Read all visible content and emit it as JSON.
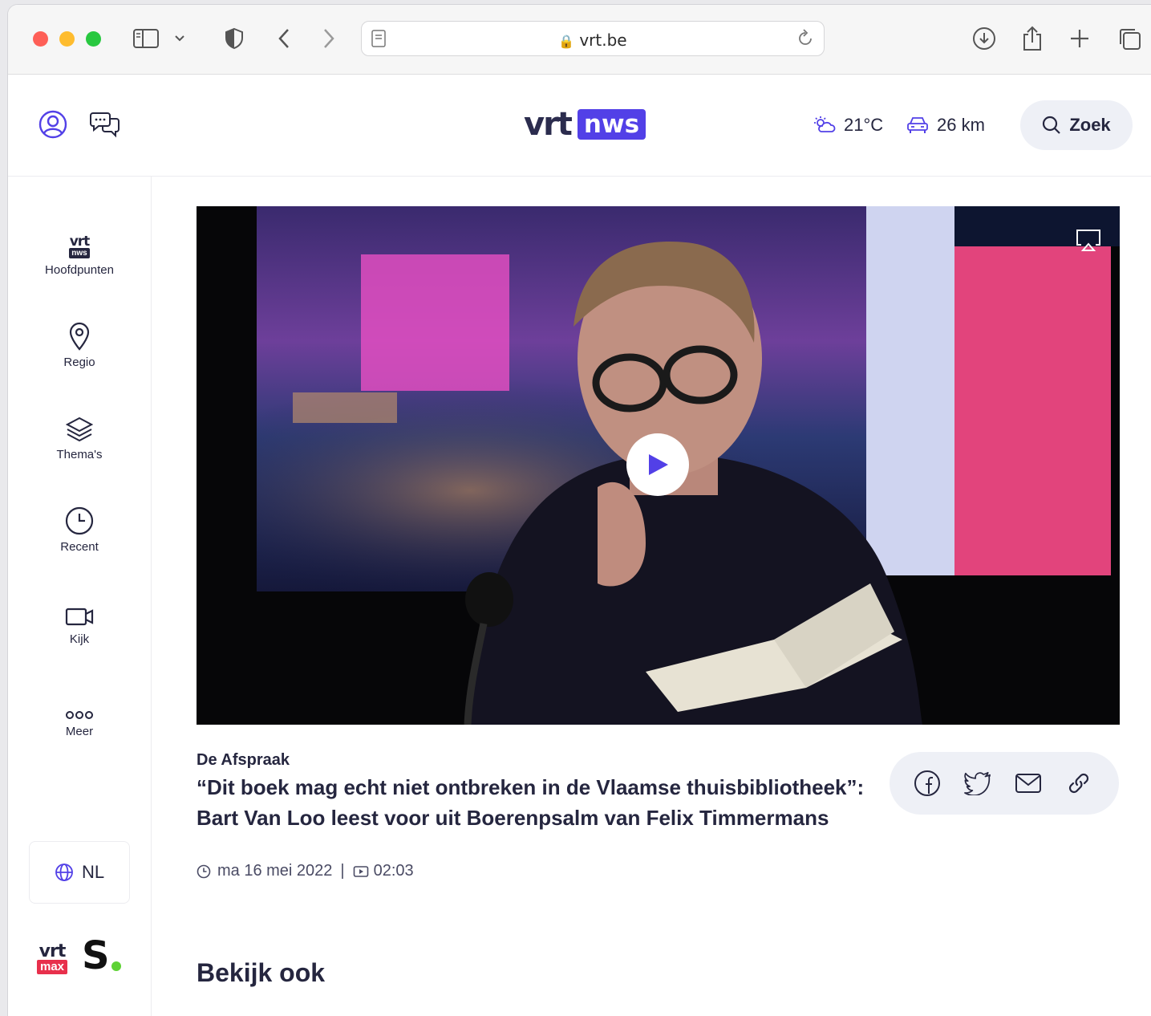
{
  "browser": {
    "url": "vrt.be"
  },
  "header": {
    "logo_left": "vrt",
    "logo_right": "nws",
    "temperature": "21°C",
    "traffic": "26 km",
    "search_label": "Zoek"
  },
  "sidebar": {
    "items": [
      {
        "label": "Hoofdpunten",
        "icon": "vrt-nws-icon"
      },
      {
        "label": "Regio",
        "icon": "location-pin-icon"
      },
      {
        "label": "Thema's",
        "icon": "layers-icon"
      },
      {
        "label": "Recent",
        "icon": "clock-icon"
      },
      {
        "label": "Kijk",
        "icon": "video-camera-icon"
      },
      {
        "label": "Meer",
        "icon": "more-icon"
      }
    ],
    "language": "NL",
    "logo_mini_top": "vrt",
    "logo_mini_nws": "nws",
    "vrtmax_top": "vrt",
    "vrtmax_bottom": "max",
    "sporza": "S"
  },
  "article": {
    "program": "De Afspraak",
    "title": "“Dit boek mag echt niet ontbreken in de Vlaamse thuisbibliotheek”: Bart Van Loo leest voor uit Boerenpsalm van Felix Timmermans",
    "date": "ma 16 mei 2022",
    "separator": "|",
    "duration": "02:03"
  },
  "section": {
    "title": "Bekijk ook"
  },
  "colors": {
    "brand": "#5240e7",
    "text": "#25263f",
    "pill": "#eef0f6",
    "vrtmax": "#e8304c",
    "sporza_dot": "#5ed235"
  }
}
